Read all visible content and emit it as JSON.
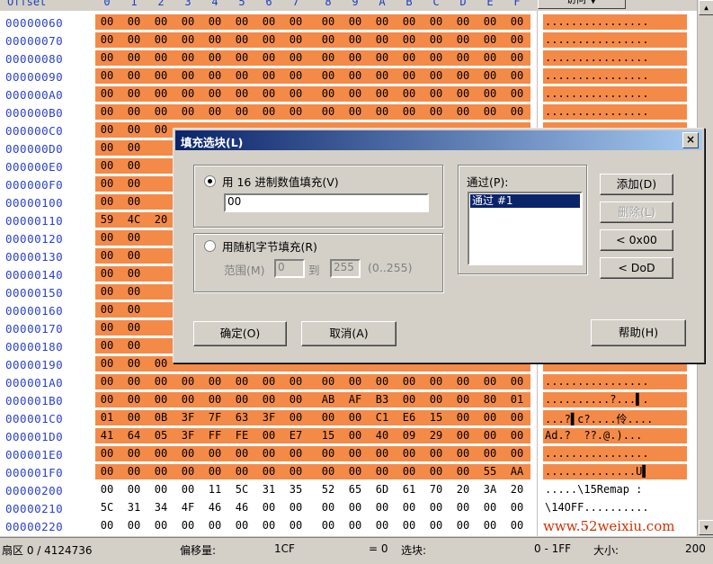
{
  "header": {
    "offset_label": "Offset",
    "columns": [
      "0",
      "1",
      "2",
      "3",
      "4",
      "5",
      "6",
      "7",
      "8",
      "9",
      "A",
      "B",
      "C",
      "D",
      "E",
      "F"
    ],
    "access_button": "访问 ▼"
  },
  "rows": [
    {
      "offset": "00000060",
      "hex": [
        "00",
        "00",
        "00",
        "00",
        "00",
        "00",
        "00",
        "00",
        "00",
        "00",
        "00",
        "00",
        "00",
        "00",
        "00",
        "00"
      ],
      "ascii": "................",
      "sel": true
    },
    {
      "offset": "00000070",
      "hex": [
        "00",
        "00",
        "00",
        "00",
        "00",
        "00",
        "00",
        "00",
        "00",
        "00",
        "00",
        "00",
        "00",
        "00",
        "00",
        "00"
      ],
      "ascii": "................",
      "sel": true
    },
    {
      "offset": "00000080",
      "hex": [
        "00",
        "00",
        "00",
        "00",
        "00",
        "00",
        "00",
        "00",
        "00",
        "00",
        "00",
        "00",
        "00",
        "00",
        "00",
        "00"
      ],
      "ascii": "................",
      "sel": true
    },
    {
      "offset": "00000090",
      "hex": [
        "00",
        "00",
        "00",
        "00",
        "00",
        "00",
        "00",
        "00",
        "00",
        "00",
        "00",
        "00",
        "00",
        "00",
        "00",
        "00"
      ],
      "ascii": "................",
      "sel": true
    },
    {
      "offset": "000000A0",
      "hex": [
        "00",
        "00",
        "00",
        "00",
        "00",
        "00",
        "00",
        "00",
        "00",
        "00",
        "00",
        "00",
        "00",
        "00",
        "00",
        "00"
      ],
      "ascii": "................",
      "sel": true
    },
    {
      "offset": "000000B0",
      "hex": [
        "00",
        "00",
        "00",
        "00",
        "00",
        "00",
        "00",
        "00",
        "00",
        "00",
        "00",
        "00",
        "00",
        "00",
        "00",
        "00"
      ],
      "ascii": "................",
      "sel": true
    },
    {
      "offset": "000000C0",
      "hex": [
        "00",
        "00",
        "00",
        "",
        "",
        "",
        "",
        "",
        "",
        "",
        "",
        "",
        "",
        "",
        "",
        ""
      ],
      "ascii": "",
      "sel": true
    },
    {
      "offset": "000000D0",
      "hex": [
        "00",
        "00",
        "",
        "",
        "",
        "",
        "",
        "",
        "",
        "",
        "",
        "",
        "",
        "",
        "",
        ""
      ],
      "ascii": "",
      "sel": true
    },
    {
      "offset": "000000E0",
      "hex": [
        "00",
        "00",
        "",
        "",
        "",
        "",
        "",
        "",
        "",
        "",
        "",
        "",
        "",
        "",
        "",
        ""
      ],
      "ascii": "",
      "sel": true
    },
    {
      "offset": "000000F0",
      "hex": [
        "00",
        "00",
        "",
        "",
        "",
        "",
        "",
        "",
        "",
        "",
        "",
        "",
        "",
        "",
        "",
        ""
      ],
      "ascii": "",
      "sel": true
    },
    {
      "offset": "00000100",
      "hex": [
        "00",
        "00",
        "",
        "",
        "",
        "",
        "",
        "",
        "",
        "",
        "",
        "",
        "",
        "",
        "",
        ""
      ],
      "ascii": "",
      "sel": true
    },
    {
      "offset": "00000110",
      "hex": [
        "59",
        "4C",
        "20",
        "",
        "",
        "",
        "",
        "",
        "",
        "",
        "",
        "",
        "",
        "",
        "",
        ""
      ],
      "ascii": "",
      "sel": true
    },
    {
      "offset": "00000120",
      "hex": [
        "00",
        "00",
        "",
        "",
        "",
        "",
        "",
        "",
        "",
        "",
        "",
        "",
        "",
        "",
        "",
        ""
      ],
      "ascii": "",
      "sel": true
    },
    {
      "offset": "00000130",
      "hex": [
        "00",
        "00",
        "",
        "",
        "",
        "",
        "",
        "",
        "",
        "",
        "",
        "",
        "",
        "",
        "",
        ""
      ],
      "ascii": "",
      "sel": true
    },
    {
      "offset": "00000140",
      "hex": [
        "00",
        "00",
        "",
        "",
        "",
        "",
        "",
        "",
        "",
        "",
        "",
        "",
        "",
        "",
        "",
        ""
      ],
      "ascii": "",
      "sel": true
    },
    {
      "offset": "00000150",
      "hex": [
        "00",
        "00",
        "",
        "",
        "",
        "",
        "",
        "",
        "",
        "",
        "",
        "",
        "",
        "",
        "",
        ""
      ],
      "ascii": "",
      "sel": true
    },
    {
      "offset": "00000160",
      "hex": [
        "00",
        "00",
        "",
        "",
        "",
        "",
        "",
        "",
        "",
        "",
        "",
        "",
        "",
        "",
        "",
        ""
      ],
      "ascii": "",
      "sel": true
    },
    {
      "offset": "00000170",
      "hex": [
        "00",
        "00",
        "",
        "",
        "",
        "",
        "",
        "",
        "",
        "",
        "",
        "",
        "",
        "",
        "",
        ""
      ],
      "ascii": "",
      "sel": true
    },
    {
      "offset": "00000180",
      "hex": [
        "00",
        "00",
        "",
        "",
        "",
        "",
        "",
        "",
        "",
        "",
        "",
        "",
        "",
        "",
        "",
        ""
      ],
      "ascii": "",
      "sel": true
    },
    {
      "offset": "00000190",
      "hex": [
        "00",
        "00",
        "00",
        "",
        "",
        "",
        "",
        "",
        "",
        "",
        "",
        "",
        "",
        "",
        "",
        ""
      ],
      "ascii": "",
      "sel": true
    },
    {
      "offset": "000001A0",
      "hex": [
        "00",
        "00",
        "00",
        "00",
        "00",
        "00",
        "00",
        "00",
        "00",
        "00",
        "00",
        "00",
        "00",
        "00",
        "00",
        "00"
      ],
      "ascii": "................",
      "sel": true
    },
    {
      "offset": "000001B0",
      "hex": [
        "00",
        "00",
        "00",
        "00",
        "00",
        "00",
        "00",
        "00",
        "AB",
        "AF",
        "B3",
        "00",
        "00",
        "00",
        "80",
        "01"
      ],
      "ascii": "..........?...▌.",
      "sel": true
    },
    {
      "offset": "000001C0",
      "hex": [
        "01",
        "00",
        "0B",
        "3F",
        "7F",
        "63",
        "3F",
        "00",
        "00",
        "00",
        "C1",
        "E6",
        "15",
        "00",
        "00",
        "00"
      ],
      "ascii": "...?▌c?....伶....",
      "sel": true
    },
    {
      "offset": "000001D0",
      "hex": [
        "41",
        "64",
        "05",
        "3F",
        "FF",
        "FE",
        "00",
        "E7",
        "15",
        "00",
        "40",
        "09",
        "29",
        "00",
        "00",
        "00"
      ],
      "ascii": "Ad.?  ??.@.)...",
      "sel": true
    },
    {
      "offset": "000001E0",
      "hex": [
        "00",
        "00",
        "00",
        "00",
        "00",
        "00",
        "00",
        "00",
        "00",
        "00",
        "00",
        "00",
        "00",
        "00",
        "00",
        "00"
      ],
      "ascii": "................",
      "sel": true
    },
    {
      "offset": "000001F0",
      "hex": [
        "00",
        "00",
        "00",
        "00",
        "00",
        "00",
        "00",
        "00",
        "00",
        "00",
        "00",
        "00",
        "00",
        "00",
        "55",
        "AA"
      ],
      "ascii": "..............U▌",
      "sel": true
    },
    {
      "offset": "00000200",
      "hex": [
        "00",
        "00",
        "00",
        "00",
        "11",
        "5C",
        "31",
        "35",
        "52",
        "65",
        "6D",
        "61",
        "70",
        "20",
        "3A",
        "20"
      ],
      "ascii": ".....\\15Remap : ",
      "sel": false
    },
    {
      "offset": "00000210",
      "hex": [
        "5C",
        "31",
        "34",
        "4F",
        "46",
        "46",
        "00",
        "00",
        "00",
        "00",
        "00",
        "00",
        "00",
        "00",
        "00",
        "00"
      ],
      "ascii": "\\14OFF..........",
      "sel": false
    },
    {
      "offset": "00000220",
      "hex": [
        "00",
        "00",
        "00",
        "00",
        "00",
        "00",
        "00",
        "00",
        "00",
        "00",
        "00",
        "00",
        "00",
        "00",
        "00",
        "00"
      ],
      "ascii": "",
      "sel": false
    }
  ],
  "watermark": "www.52weixiu.com",
  "status": {
    "sector": "扇区 0 / 4124736",
    "offset_label": "偏移量:",
    "offset_value": "1CF",
    "equals": "= 0",
    "selection_label": "选块:",
    "selection_range": "0 - 1FF",
    "size_label": "大小:",
    "size_value": "200"
  },
  "dialog": {
    "title": "填充选块(L)",
    "close": "×",
    "hex_fill_label": "用 16 进制数值填充(V)",
    "hex_value": "00",
    "random_fill_label": "用随机字节填充(R)",
    "range_label": "范围(M)",
    "range_from": "0",
    "to_label": "到",
    "range_to": "255",
    "range_hint": "(0..255)",
    "passes_label": "通过(P):",
    "passes_items": [
      "通过 #1"
    ],
    "add_button": "添加(D)",
    "delete_button": "删除(L)",
    "btn_0x00": "< 0x00",
    "btn_dod": "< DoD",
    "ok_button": "确定(O)",
    "cancel_button": "取消(A)",
    "help_button": "帮助(H)"
  }
}
